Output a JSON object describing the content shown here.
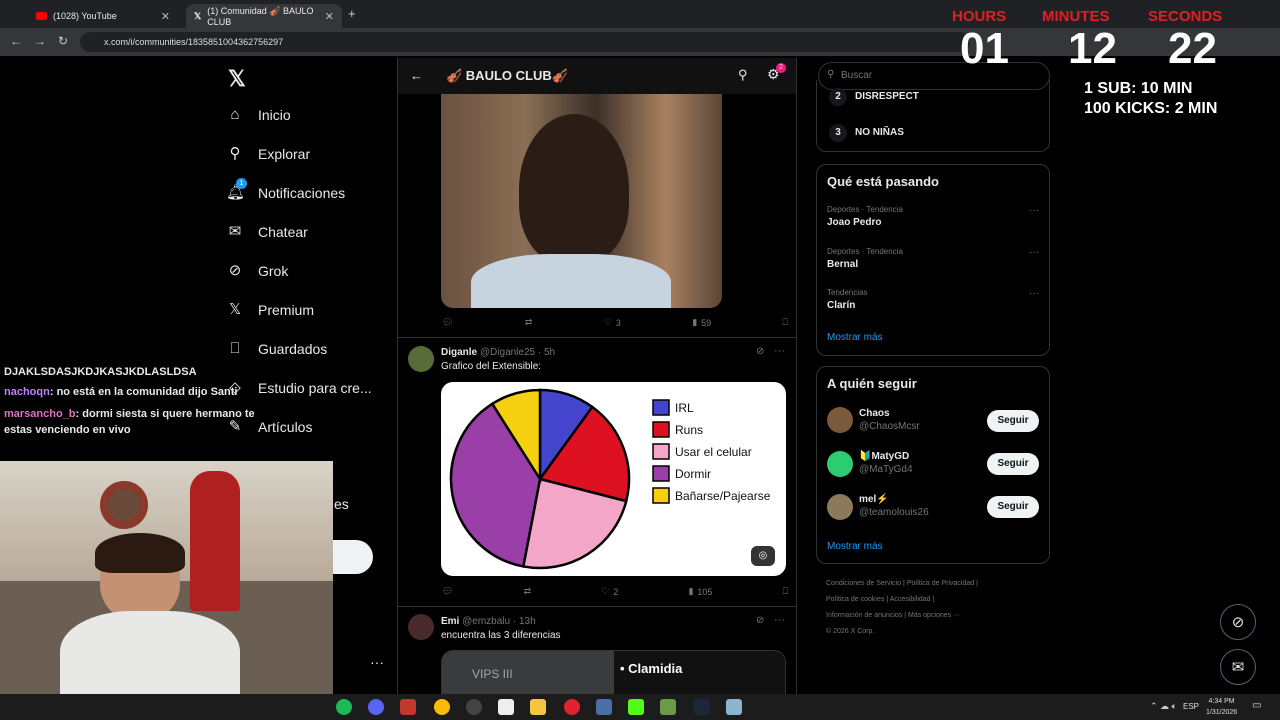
{
  "browser": {
    "tabs": [
      {
        "label": "(1028) YouTube"
      },
      {
        "label": "(1) Comunidad 🎻 BAULO CLUB"
      }
    ],
    "url": "x.com/i/communities/1835851004362756297"
  },
  "nav": {
    "items": [
      {
        "label": "Inicio",
        "icon": "home-icon"
      },
      {
        "label": "Explorar",
        "icon": "search-icon"
      },
      {
        "label": "Notificaciones",
        "icon": "bell-icon",
        "badge": "1"
      },
      {
        "label": "Chatear",
        "icon": "mail-icon"
      },
      {
        "label": "Grok",
        "icon": "grok-icon"
      },
      {
        "label": "Premium",
        "icon": "x-icon"
      },
      {
        "label": "Guardados",
        "icon": "bookmark-icon"
      },
      {
        "label": "Estudio para cre...",
        "icon": "studio-icon"
      },
      {
        "label": "Artículos",
        "icon": "article-icon"
      }
    ],
    "partial_label": "es",
    "more": "···"
  },
  "feed": {
    "title": "🎻 BAULO CLUB🎻",
    "settings_badge": "2",
    "post1": {
      "likes": "3",
      "views": "59"
    },
    "post2": {
      "name": "Diganle",
      "handle": "@Diganle25",
      "time": "· 5h",
      "text": "Grafico del Extensible:",
      "likes": "2",
      "views": "105"
    },
    "post3": {
      "name": "Emi",
      "handle": "@emzbalu",
      "time": "· 13h",
      "text": "encuentra las 3 diferencias",
      "img_label": "VIPS III",
      "img_list": "Clamidia"
    }
  },
  "chart_data": {
    "type": "pie",
    "labels": [
      "IRL",
      "Runs",
      "Usar el celular",
      "Dormir",
      "Bañarse/Pajearse"
    ],
    "values": [
      10,
      19,
      24,
      38,
      9
    ],
    "colors": [
      "#4444cc",
      "#dd1122",
      "#f4a6c8",
      "#9b3fa8",
      "#f5d010"
    ]
  },
  "right": {
    "search_placeholder": "Buscar",
    "rules": [
      {
        "num": "2",
        "text": "DISRESPECT"
      },
      {
        "num": "3",
        "text": "NO NIÑAS"
      }
    ],
    "trending_title": "Qué está pasando",
    "trends": [
      {
        "meta": "Deportes · Tendencia",
        "name": "Joao Pedro"
      },
      {
        "meta": "Deportes · Tendencia",
        "name": "Bernal"
      },
      {
        "meta": "Tendencias",
        "name": "Clarín"
      }
    ],
    "show_more": "Mostrar más",
    "follow_title": "A quién seguir",
    "follow": [
      {
        "name": "Chaos",
        "handle": "@ChaosMcsr",
        "btn": "Seguir"
      },
      {
        "name": "🔰MatyGD",
        "handle": "@MaTyGd4",
        "btn": "Seguir"
      },
      {
        "name": "mel⚡",
        "handle": "@teamolouis26",
        "btn": "Seguir"
      }
    ],
    "footer": [
      "Condiciones de Servicio",
      "Política de Privacidad",
      "Política de cookies",
      "Accesibilidad",
      "Información de anuncios",
      "Más opciones ···",
      "© 2026 X Corp."
    ]
  },
  "timer": {
    "h_label": "HOURS",
    "m_label": "MINUTES",
    "s_label": "SECONDS",
    "h": "01",
    "m": "12",
    "s": "22",
    "line1": "1 SUB: 10 MIN",
    "line2": "100 KICKS: 2 MIN"
  },
  "chat": [
    {
      "user": "",
      "text": "DJAKLSDASJKDJKASJKDLASLDSA"
    },
    {
      "user": "nachoqn",
      "text": ": no está en la comunidad dijo Santi"
    },
    {
      "user": "marsancho_b",
      "text": ": dormi siesta si quere hermano te estas venciendo en vivo"
    }
  ],
  "taskbar": {
    "lang": "ESP",
    "time": "4:34 PM",
    "date": "1/31/2026"
  }
}
